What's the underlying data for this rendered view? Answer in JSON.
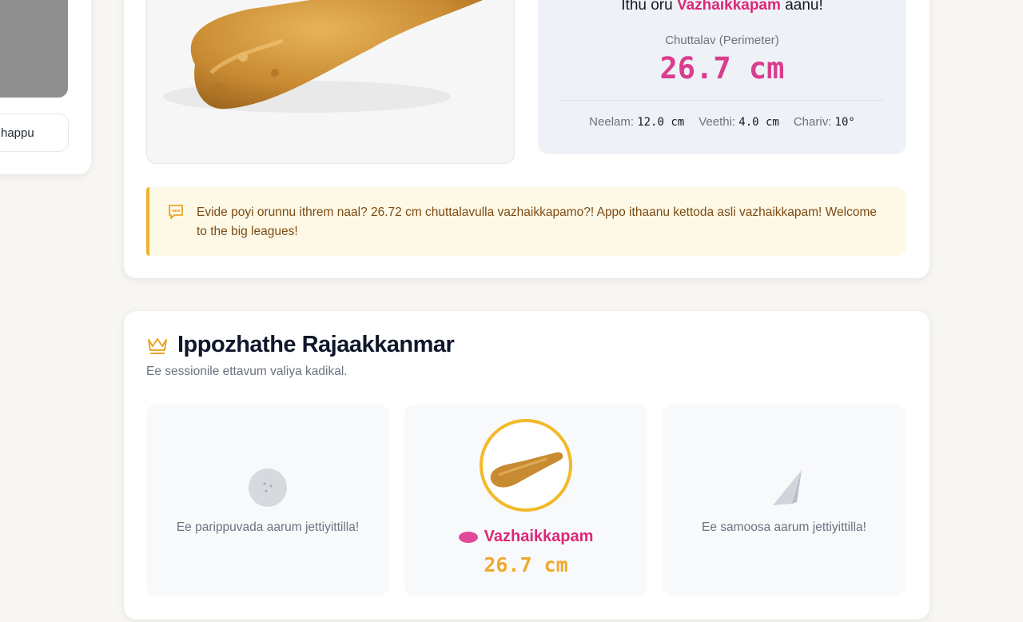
{
  "left_panel": {
    "button_label": "happu"
  },
  "result": {
    "verdict_prefix": "Ithu oru",
    "verdict_name": "Vazhaikkapam",
    "verdict_suffix": "aanu!",
    "perimeter_label": "Chuttalav (Perimeter)",
    "perimeter_value": "26.7 cm",
    "length_label": "Neelam:",
    "length_value": "12.0 cm",
    "width_label": "Veethi:",
    "width_value": "4.0 cm",
    "angle_label": "Chariv:",
    "angle_value": "10°",
    "quote": "Evide poyi orunnu ithrem naal? 26.72 cm chuttalavulla vazhaikkapamo?! Appo ithaanu kettoda asli vazhaikkapam! Welcome to the big leagues!"
  },
  "leaderboard": {
    "title": "Ippozhathe Rajaakkanmar",
    "subtitle": "Ee sessionile ettavum valiya kadikal.",
    "slots": [
      {
        "empty_text": "Ee parippuvada aarum jettiyittilla!",
        "icon": "parippuvada-icon"
      },
      {
        "name": "Vazhaikkapam",
        "value": "26.7 cm",
        "icon": "vazhaikkapam-icon"
      },
      {
        "empty_text": "Ee samoosa aarum jettiyittilla!",
        "icon": "samoosa-icon"
      }
    ]
  },
  "colors": {
    "accent_pink": "#db2777",
    "gold": "#f2b929",
    "quote_bg": "#fef9e6"
  }
}
